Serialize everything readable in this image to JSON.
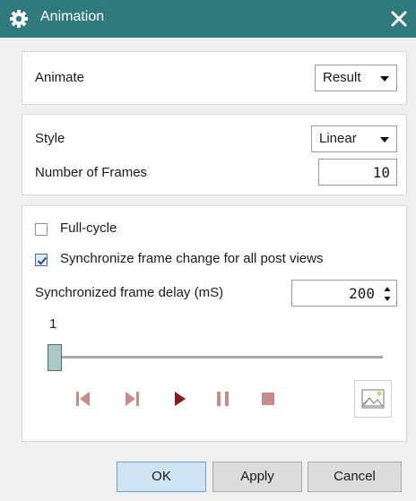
{
  "window": {
    "title": "Animation",
    "accent_color": "#2f7a7c",
    "icon": "gear-icon",
    "close_icon": "close-icon"
  },
  "animate": {
    "label": "Animate",
    "selected": "Result"
  },
  "style_section": {
    "style_label": "Style",
    "style_selected": "Linear",
    "frames_label": "Number of Frames",
    "frames_value": "10"
  },
  "playback": {
    "full_cycle_label": "Full-cycle",
    "full_cycle_checked": false,
    "sync_label": "Synchronize frame change for all post views",
    "sync_checked": true,
    "delay_label": "Synchronized frame delay (mS)",
    "delay_value": "200",
    "slider_value_label": "1",
    "slider_position": 0,
    "controls": [
      "first-frame",
      "next-frame",
      "play",
      "pause",
      "stop"
    ],
    "play_color": "#8b1a1a",
    "control_color": "#c98a8a",
    "image_button_icon": "image-icon"
  },
  "footer": {
    "ok_label": "OK",
    "apply_label": "Apply",
    "cancel_label": "Cancel"
  }
}
